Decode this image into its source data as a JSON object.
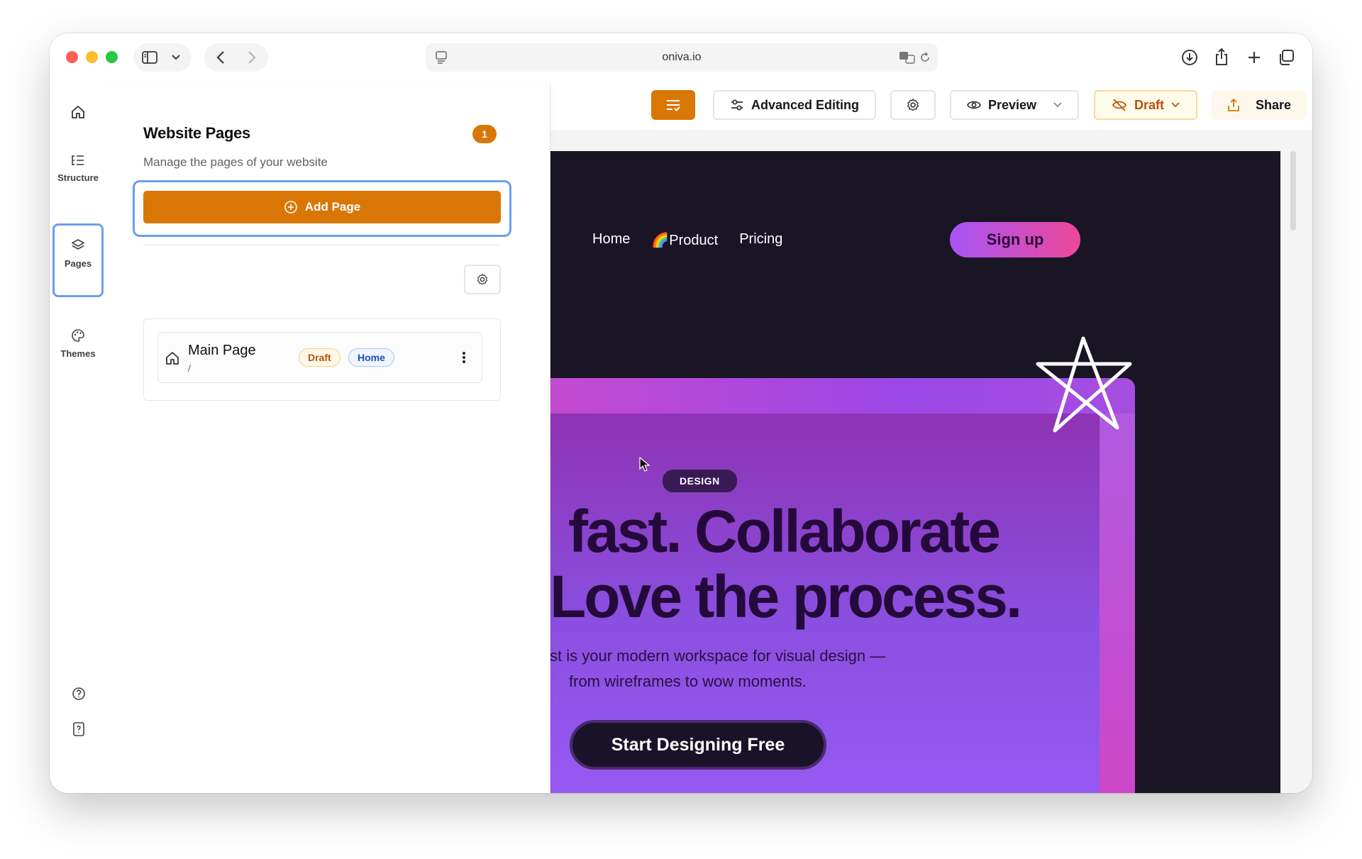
{
  "browser": {
    "url": "oniva.io"
  },
  "toolbar": {
    "advanced_editing": "Advanced Editing",
    "preview": "Preview",
    "draft": "Draft",
    "share": "Share"
  },
  "rail": {
    "structure": "Structure",
    "pages": "Pages",
    "themes": "Themes"
  },
  "panel": {
    "title": "Website Pages",
    "count": "1",
    "subtitle": "Manage the pages of your website",
    "add_page": "Add Page",
    "pages": [
      {
        "name": "Main Page",
        "path": "/",
        "status": "Draft",
        "tag": "Home"
      }
    ]
  },
  "site": {
    "nav": [
      "Home",
      "🌈Product",
      "Pricing"
    ],
    "signup": "Sign up",
    "badge": "DESIGN",
    "headline_1": "fast. Collaborate",
    "headline_2": "Love the process.",
    "sub_1": "st is your modern workspace for visual design —",
    "sub_2": "from wireframes to wow moments.",
    "cta": "Start Designing Free"
  },
  "colors": {
    "accent": "#d97706",
    "focus_ring": "#6b9ff0",
    "hero_text": "#240a3a"
  }
}
